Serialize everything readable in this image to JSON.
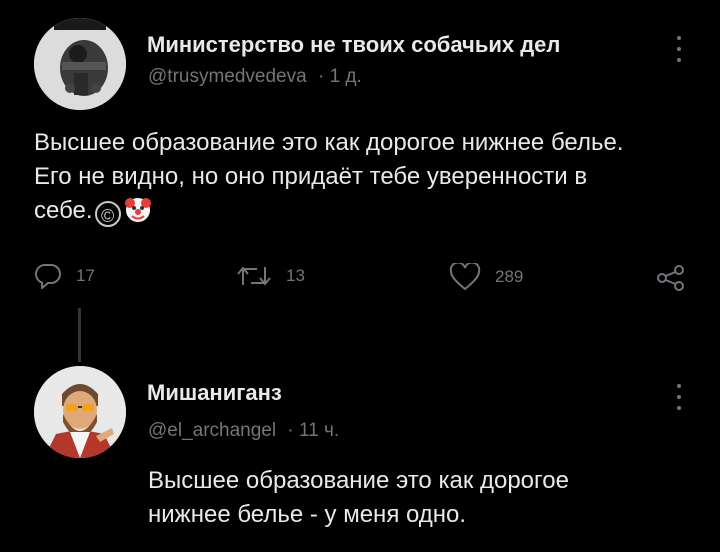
{
  "tweet": {
    "author_name": "Министерство не твоих собачьих дел",
    "handle": "@trusymedvedeva",
    "time": "· 1 д.",
    "text": "Высшее образование это как дорогое нижнее белье. Его не видно, но оно придаёт тебе уверенности в себе.",
    "emoji_copyright": "©",
    "actions": {
      "replies": "17",
      "retweets": "13",
      "likes": "289"
    }
  },
  "reply": {
    "author_name": "Мишаниганз",
    "handle": "@el_archangel",
    "time": "· 11 ч.",
    "text": "Высшее образование это как дорогое нижнее белье - у меня одно."
  },
  "colors": {
    "background": "#000000",
    "text": "#e7e9ea",
    "muted": "#71767b"
  },
  "icons": [
    "reply-icon",
    "retweet-icon",
    "like-icon",
    "share-icon",
    "more-icon"
  ]
}
